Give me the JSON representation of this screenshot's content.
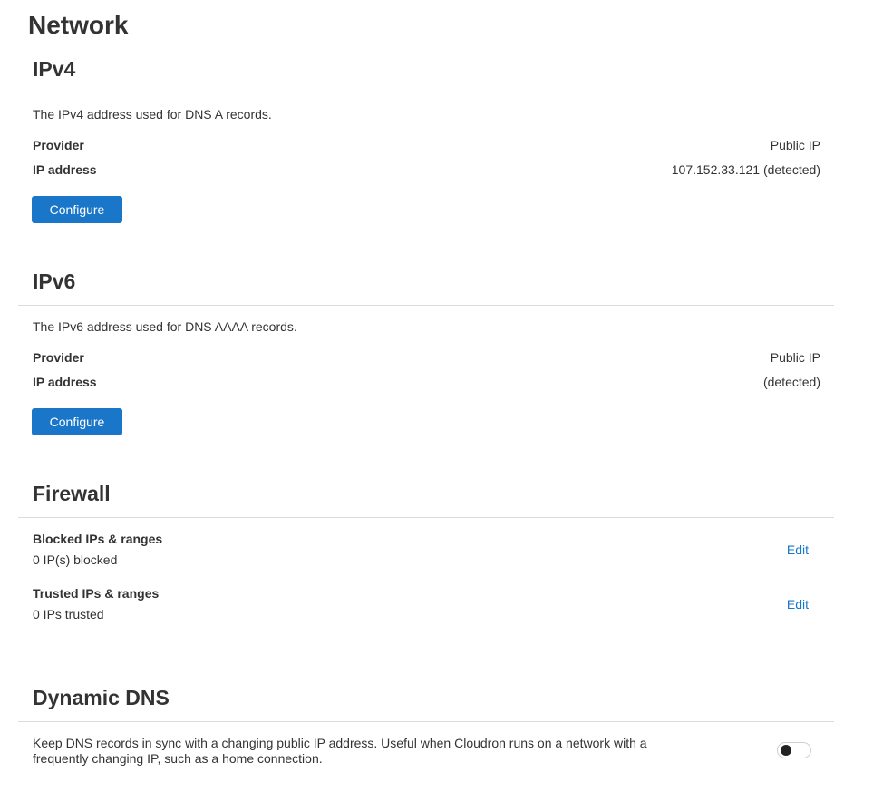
{
  "page": {
    "title": "Network"
  },
  "ipv4": {
    "title": "IPv4",
    "description": "The IPv4 address used for DNS A records.",
    "provider_label": "Provider",
    "provider_value": "Public IP",
    "ip_label": "IP address",
    "ip_value": "107.152.33.121 (detected)",
    "configure_label": "Configure"
  },
  "ipv6": {
    "title": "IPv6",
    "description": "The IPv6 address used for DNS AAAA records.",
    "provider_label": "Provider",
    "provider_value": "Public IP",
    "ip_label": "IP address",
    "ip_value": "(detected)",
    "configure_label": "Configure"
  },
  "firewall": {
    "title": "Firewall",
    "blocked_label": "Blocked IPs & ranges",
    "blocked_value": "0 IP(s) blocked",
    "blocked_edit": "Edit",
    "trusted_label": "Trusted IPs & ranges",
    "trusted_value": "0 IPs trusted",
    "trusted_edit": "Edit"
  },
  "dynamic_dns": {
    "title": "Dynamic DNS",
    "description": "Keep DNS records in sync with a changing public IP address. Useful when Cloudron runs on a network with a frequently changing IP, such as a home connection.",
    "enabled": false
  },
  "colors": {
    "accent": "#1a76c9",
    "text": "#333333",
    "divider": "#dcdcdc"
  }
}
